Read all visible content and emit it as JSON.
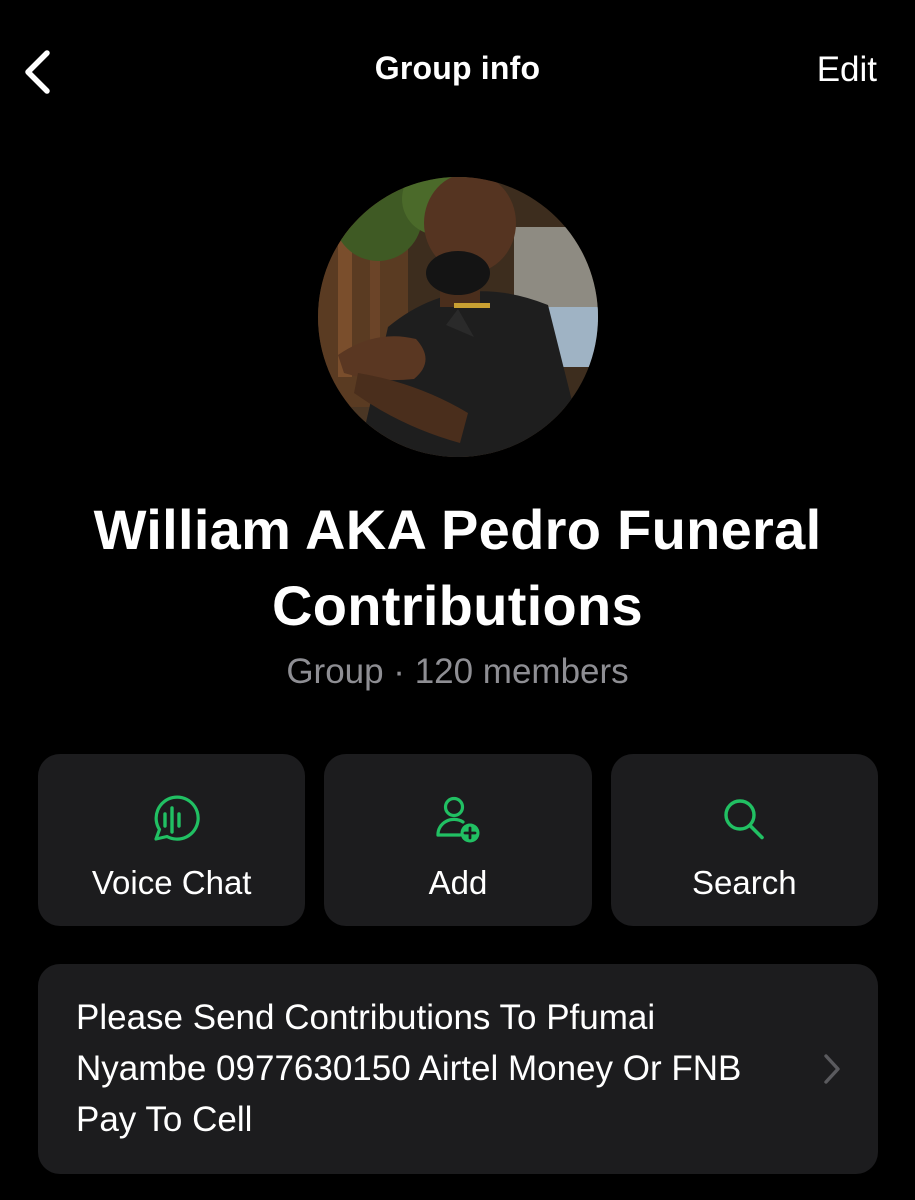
{
  "nav": {
    "title": "Group info",
    "edit_label": "Edit"
  },
  "group": {
    "name": "William AKA Pedro Funeral Contributions",
    "meta": "Group · 120 members"
  },
  "actions": [
    {
      "label": "Voice Chat",
      "icon": "voice-chat-icon"
    },
    {
      "label": "Add",
      "icon": "add-member-icon"
    },
    {
      "label": "Search",
      "icon": "search-icon"
    }
  ],
  "description": {
    "text": "Please Send Contributions To Pfumai Nyambe 0977630150 Airtel Money Or FNB Pay To Cell"
  },
  "colors": {
    "background": "#000000",
    "card": "#1c1c1e",
    "accent": "#21c063",
    "secondary_text": "#8e8e93",
    "chevron": "#5a5a5e"
  }
}
